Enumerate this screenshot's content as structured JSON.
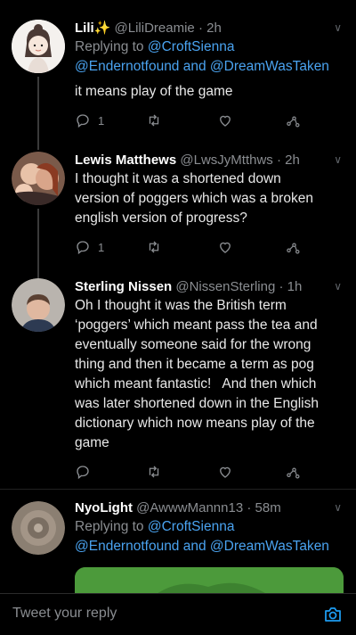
{
  "tweets": [
    {
      "name": "Lili✨",
      "handle": "@LiliDreamie",
      "time": "· 2h",
      "replying_prefix": "Replying to ",
      "reply_to_1": "@CroftSienna",
      "reply_to_2": "@Endernotfound and @DreamWasTaken",
      "text": "it means play of the game",
      "reply_count": "1"
    },
    {
      "name": "Lewis Matthews",
      "handle": "@LwsJyMtthws",
      "time": "· 2h",
      "text_lines": [
        "I thought it was a shortened down",
        "version of poggers which was a broken",
        "english version of progress?"
      ],
      "reply_count": "1"
    },
    {
      "name": "Sterling Nissen",
      "handle": "@NissenSterling",
      "time": "· 1h",
      "text_lines": [
        "Oh I thought it was the British term",
        "‘poggers’ which meant pass the tea and",
        "eventually someone said for the wrong",
        "thing and then it became a term as pog",
        "which meant fantastic!   And then which",
        "was later shortened down in the English",
        "dictionary which now means play of the",
        "game"
      ]
    },
    {
      "name": "NyoLight",
      "handle": "@AwwwMannn13",
      "time": "· 58m",
      "replying_prefix": "Replying to ",
      "reply_to_1": "@CroftSienna",
      "reply_to_2": "@Endernotfound and @DreamWasTaken"
    }
  ],
  "composer": {
    "placeholder": "Tweet your reply"
  },
  "icons": [
    "reply-icon",
    "retweet-icon",
    "like-icon",
    "share-icon",
    "camera-icon",
    "chevron-down-icon"
  ],
  "colors": {
    "background": "#000000",
    "link": "#4aa3f0",
    "muted": "#8a8d91"
  }
}
